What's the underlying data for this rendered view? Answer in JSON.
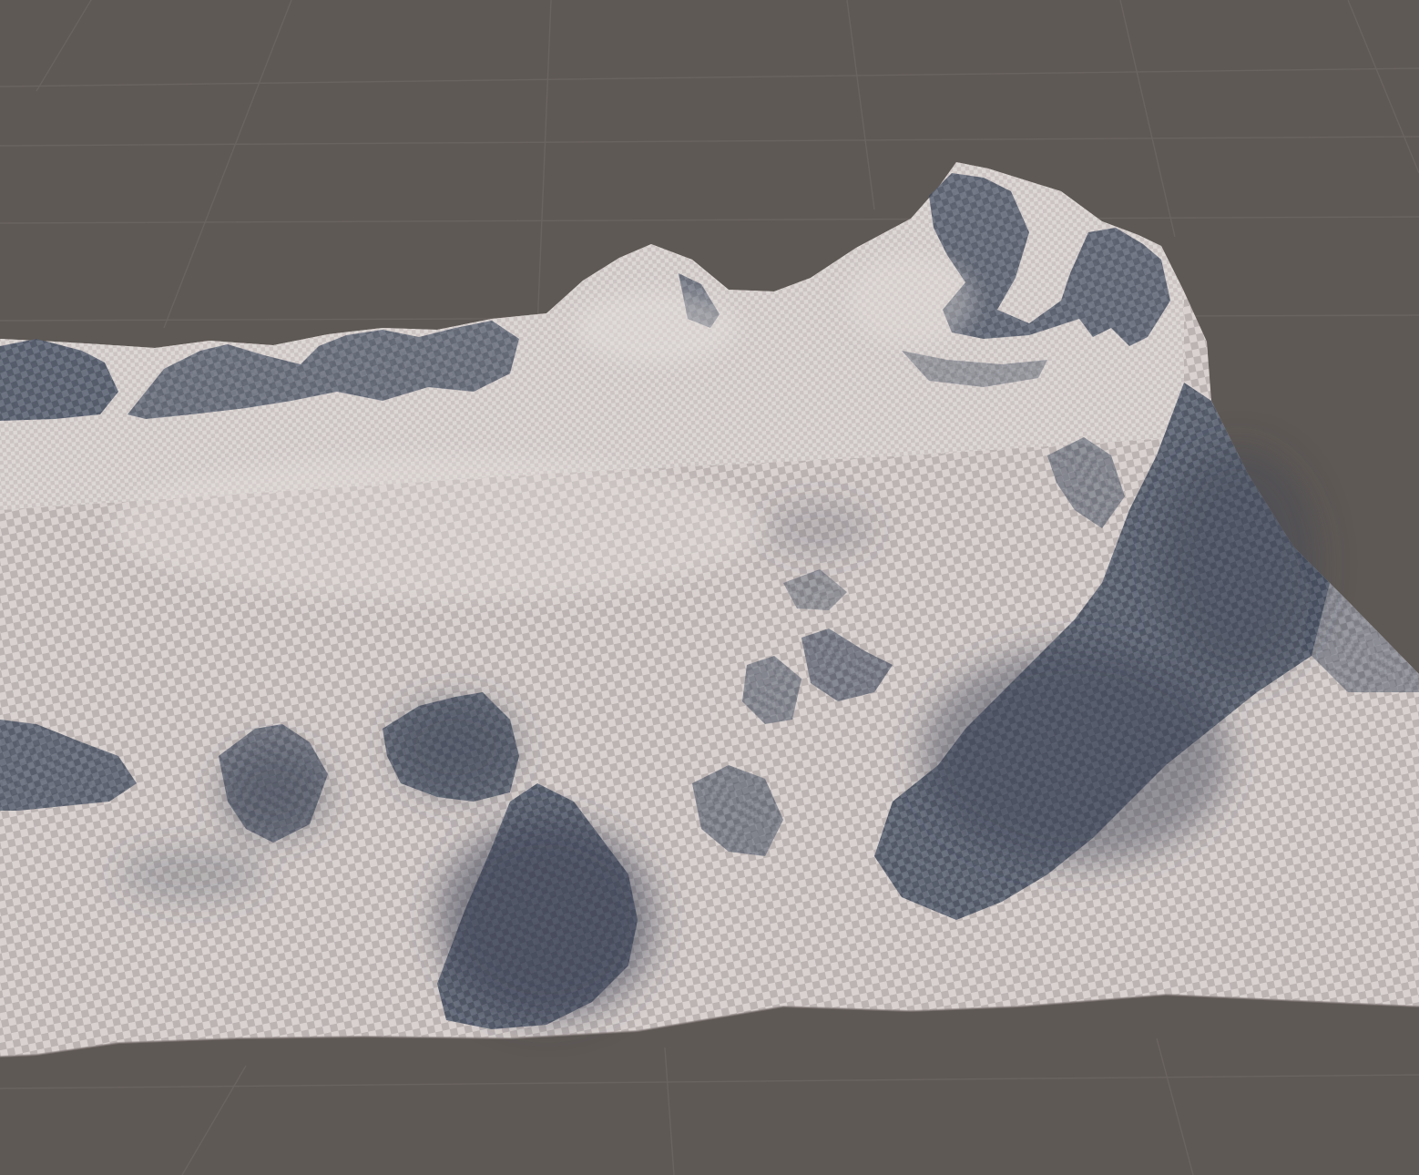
{
  "scene": {
    "view": "scene-viewport",
    "object": "terrain",
    "material": "default-checker",
    "colors": {
      "background": "#5f5955",
      "grid_line": "#6a6460",
      "terrain_light": "#ddd6d4",
      "terrain_mid": "#c9c1c0",
      "terrain_shadow": "#4d5666",
      "terrain_deep_shadow": "#3e4656"
    }
  }
}
